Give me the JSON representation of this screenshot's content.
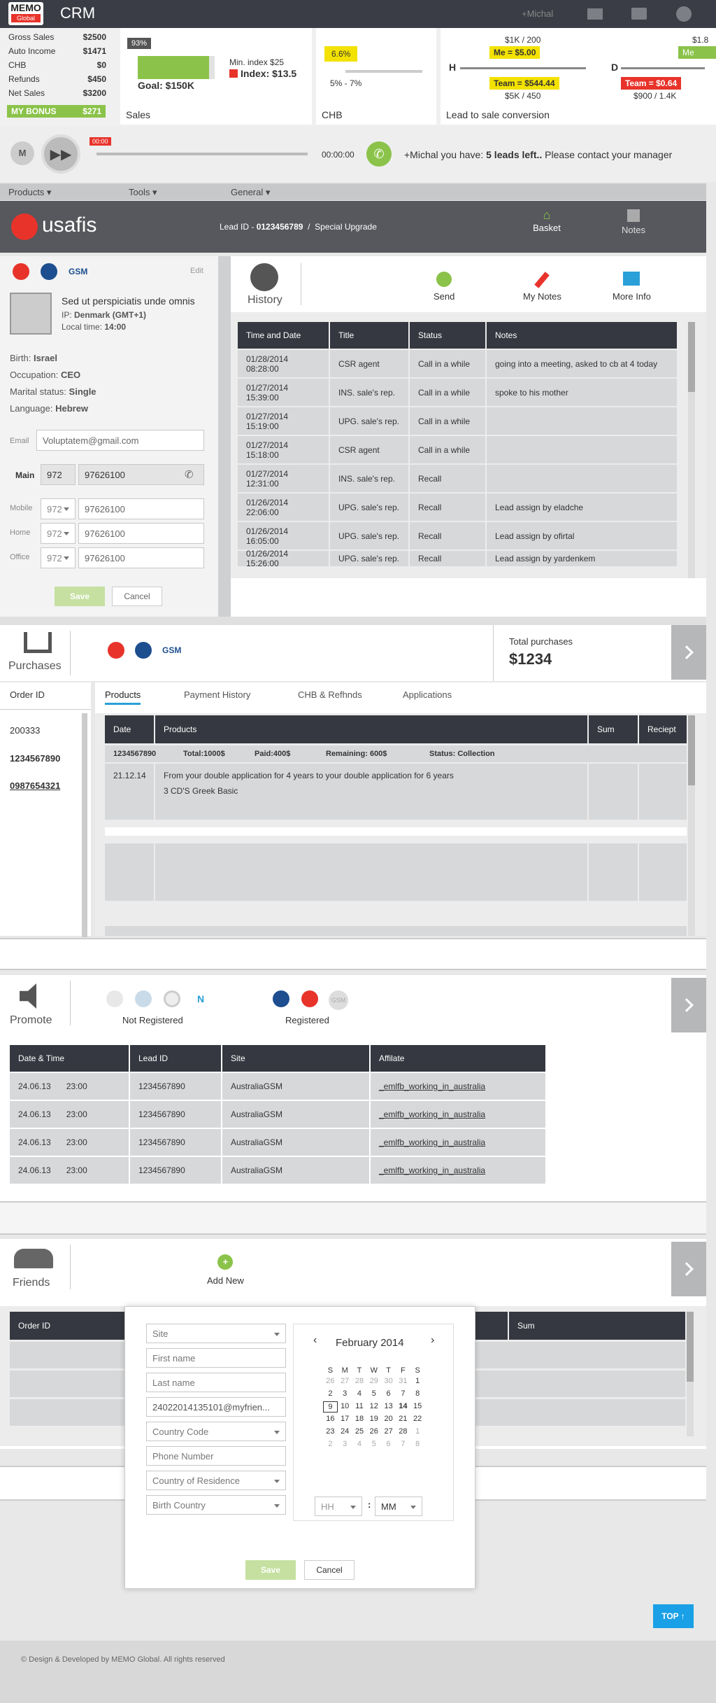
{
  "topbar": {
    "logo_main": "MEMO",
    "logo_sub": "Global",
    "app": "CRM",
    "user": "+Michal"
  },
  "stats": [
    [
      "Gross Sales",
      "$2500"
    ],
    [
      "Auto Income",
      "$1471"
    ],
    [
      "CHB",
      "$0"
    ],
    [
      "Refunds",
      "$450"
    ],
    [
      "Net Sales",
      "$3200"
    ]
  ],
  "bonus": {
    "label": "MY BONUS",
    "value": "$271"
  },
  "sales": {
    "pct": "93%",
    "goal": "Goal: $150K",
    "min": "Min. index $25",
    "index": "Index: $13.5",
    "title": "Sales",
    "progress": 0.93
  },
  "chb": {
    "badge": "6.6%",
    "range": "5% - 7%",
    "title": "CHB"
  },
  "conv": {
    "h": "H",
    "d": "D",
    "top1": "$1K / 200",
    "me": "Me = $5.00",
    "team": "Team = $544.44",
    "bottom1": "$5K / 450",
    "team2": "Team = $0.64",
    "bottom2": "$900 / 1.4K",
    "title": "Lead to sale conversion",
    "edge_top": "$1.8",
    "edge_me": "Me"
  },
  "player": {
    "m": "M",
    "timer": "00:00",
    "time": "00:00:00",
    "msg_pre": "+Michal you have: ",
    "msg_bold": "5 leads left..",
    "msg_post": " Please contact your manager"
  },
  "menu": [
    "Products",
    "Tools",
    "General"
  ],
  "brand": {
    "name": "usafis",
    "lead_label": "Lead ID - ",
    "lead_id": "0123456789",
    "sep": "/",
    "upgrade": "Special Upgrade",
    "basket": "Basket",
    "notes": "Notes"
  },
  "contact": {
    "gsm": "GSM",
    "edit": "Edit",
    "name": "Sed ut perspiciatis unde omnis",
    "ip_label": "IP: ",
    "ip": "Denmark (GMT+1)",
    "time_label": "Local time: ",
    "time": "14:00",
    "details": [
      [
        "Birth: ",
        "Israel"
      ],
      [
        "Occupation: ",
        "CEO"
      ],
      [
        "Marital status: ",
        "Single"
      ],
      [
        "Language: ",
        "Hebrew"
      ]
    ],
    "email_label": "Email",
    "email": "Voluptatem@gmail.com",
    "main_label": "Main",
    "main_code": "972",
    "main_phone": "97626100",
    "phones": [
      [
        "Mobile",
        "972",
        "97626100"
      ],
      [
        "Home",
        "972",
        "97626100"
      ],
      [
        "Office",
        "972",
        "97626100"
      ]
    ],
    "save": "Save",
    "cancel": "Cancel"
  },
  "history": {
    "title": "History",
    "send": "Send",
    "mynotes": "My Notes",
    "moreinfo": "More Info",
    "headers": [
      "Time and Date",
      "Title",
      "Status",
      "Notes"
    ],
    "rows": [
      [
        "01/28/2014 08:28:00",
        "CSR agent",
        "Call in a while",
        "going into a meeting, asked to cb at 4 today"
      ],
      [
        "01/27/2014 15:39:00",
        "INS. sale's rep.",
        "Call in a while",
        "spoke to his mother"
      ],
      [
        "01/27/2014 15:19:00",
        "UPG. sale's rep.",
        "Call in a while",
        ""
      ],
      [
        "01/27/2014 15:18:00",
        "CSR agent",
        "Call in a while",
        ""
      ],
      [
        "01/27/2014 12:31:00",
        "INS. sale's rep.",
        "Recall",
        ""
      ],
      [
        "01/26/2014 22:06:00",
        "UPG. sale's rep.",
        "Recall",
        "Lead assign by eladche"
      ],
      [
        "01/26/2014 16:05:00",
        "UPG. sale's rep.",
        "Recall",
        "Lead assign by ofirtal"
      ],
      [
        "01/26/2014 15:26:00",
        "UPG. sale's rep.",
        "Recall",
        "Lead assign by yardenkem"
      ]
    ]
  },
  "purchases": {
    "title": "Purchases",
    "gsm": "GSM",
    "total_label": "Total purchases",
    "total": "$1234",
    "order_label": "Order ID",
    "orders": [
      "200333",
      "1234567890",
      "0987654321"
    ],
    "tabs": [
      "Products",
      "Payment History",
      "CHB & Refhnds",
      "Applications"
    ],
    "headers": [
      "Date",
      "Products",
      "Sum",
      "Reciept"
    ],
    "summary": [
      "1234567890",
      "Total:1000$",
      "Paid:400$",
      "Remaining: 600$",
      "Status: Collection"
    ],
    "row_date": "21.12.14",
    "row_line1": "From your double application for 4 years to your double application for 6 years",
    "row_line2": "3 CD'S Greek Basic"
  },
  "promote": {
    "title": "Promote",
    "not_reg": "Not Registered",
    "reg": "Registered",
    "gsm": "GSM",
    "n": "N",
    "headers": [
      "Date & Time",
      "Lead ID",
      "Site",
      "Affilate"
    ],
    "rows": [
      [
        "24.06.13",
        "23:00",
        "1234567890",
        "AustraliaGSM",
        "_emlfb_working_in_australia"
      ],
      [
        "24.06.13",
        "23:00",
        "1234567890",
        "AustraliaGSM",
        "_emlfb_working_in_australia"
      ],
      [
        "24.06.13",
        "23:00",
        "1234567890",
        "AustraliaGSM",
        "_emlfb_working_in_australia"
      ],
      [
        "24.06.13",
        "23:00",
        "1234567890",
        "AustraliaGSM",
        "_emlfb_working_in_australia"
      ]
    ]
  },
  "friends": {
    "title": "Friends",
    "add": "Add New",
    "order": "Order ID",
    "sum": "Sum"
  },
  "form": {
    "fields": [
      "Site",
      "First name",
      "Last name",
      "24022014135101@myfrien...",
      "Country Code",
      "Phone Number",
      "Country of Residence",
      "Birth Country"
    ],
    "month": "February 2014",
    "days": [
      "S",
      "M",
      "T",
      "W",
      "T",
      "F",
      "S"
    ],
    "weeks": [
      [
        "26",
        "27",
        "28",
        "29",
        "30",
        "31",
        "1"
      ],
      [
        "2",
        "3",
        "4",
        "5",
        "6",
        "7",
        "8"
      ],
      [
        "9",
        "10",
        "11",
        "12",
        "13",
        "14",
        "15"
      ],
      [
        "16",
        "17",
        "18",
        "19",
        "20",
        "21",
        "22"
      ],
      [
        "23",
        "24",
        "25",
        "26",
        "27",
        "28",
        "1"
      ],
      [
        "2",
        "3",
        "4",
        "5",
        "6",
        "7",
        "8"
      ]
    ],
    "hh": "HH",
    "mm": "MM",
    "colon": ":",
    "save": "Save",
    "cancel": "Cancel"
  },
  "top": "TOP",
  "footer": "© Design & Developed by MEMO Global. All rights reserved"
}
